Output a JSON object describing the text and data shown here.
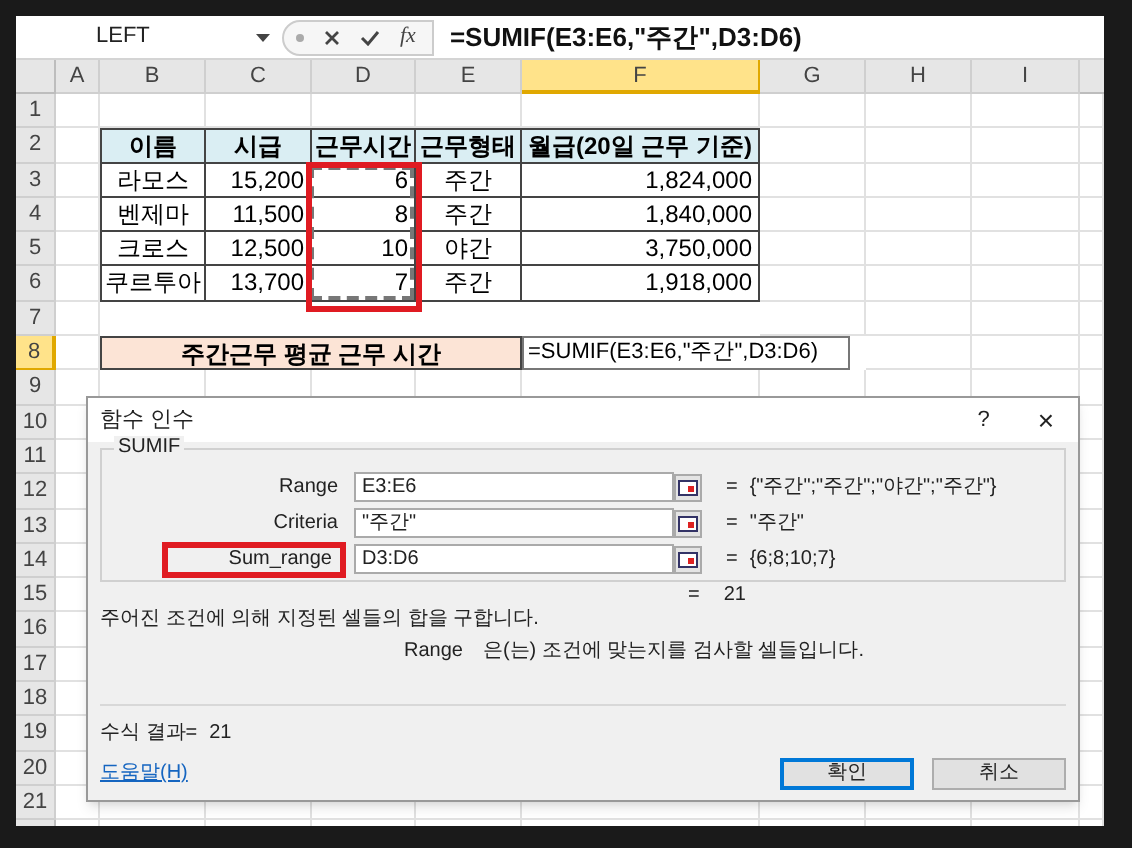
{
  "formula_bar": {
    "name_box": "LEFT",
    "fx": "fx",
    "formula": "=SUMIF(E3:E6,\"주간\",D3:D6)"
  },
  "columns": [
    {
      "label": "A",
      "selected": false
    },
    {
      "label": "B",
      "selected": false
    },
    {
      "label": "C",
      "selected": false
    },
    {
      "label": "D",
      "selected": false
    },
    {
      "label": "E",
      "selected": false
    },
    {
      "label": "F",
      "selected": true
    },
    {
      "label": "G",
      "selected": false
    },
    {
      "label": "H",
      "selected": false
    },
    {
      "label": "I",
      "selected": false
    }
  ],
  "rows": [
    {
      "label": "1",
      "selected": false
    },
    {
      "label": "2",
      "selected": false
    },
    {
      "label": "3",
      "selected": false
    },
    {
      "label": "4",
      "selected": false
    },
    {
      "label": "5",
      "selected": false
    },
    {
      "label": "6",
      "selected": false
    },
    {
      "label": "7",
      "selected": false
    },
    {
      "label": "8",
      "selected": true
    },
    {
      "label": "9",
      "selected": false
    },
    {
      "label": "10",
      "selected": false
    },
    {
      "label": "11",
      "selected": false
    },
    {
      "label": "12",
      "selected": false
    },
    {
      "label": "13",
      "selected": false
    },
    {
      "label": "14",
      "selected": false
    },
    {
      "label": "15",
      "selected": false
    },
    {
      "label": "16",
      "selected": false
    },
    {
      "label": "17",
      "selected": false
    },
    {
      "label": "18",
      "selected": false
    },
    {
      "label": "19",
      "selected": false
    },
    {
      "label": "20",
      "selected": false
    },
    {
      "label": "21",
      "selected": false
    }
  ],
  "table": {
    "columns": [
      "이름",
      "시급",
      "근무시간",
      "근무형태",
      "월급(20일 근무 기준)"
    ],
    "rows": [
      [
        "라모스",
        "15,200",
        "6",
        "주간",
        "1,824,000"
      ],
      [
        "벤제마",
        "11,500",
        "8",
        "주간",
        "1,840,000"
      ],
      [
        "크로스",
        "12,500",
        "10",
        "야간",
        "3,750,000"
      ],
      [
        "쿠르투아",
        "13,700",
        "7",
        "주간",
        "1,918,000"
      ]
    ]
  },
  "summary": {
    "label": "주간근무 평균 근무 시간",
    "formula": "=SUMIF(E3:E6,\"주간\",D3:D6)"
  },
  "dialog": {
    "title": "함수 인수",
    "help": "?",
    "close": "×",
    "function": "SUMIF",
    "arguments": [
      {
        "label": "Range",
        "value": "E3:E6",
        "equals": "=",
        "result": "{\"주간\";\"주간\";\"야간\";\"주간\"}",
        "highlighted": false
      },
      {
        "label": "Criteria",
        "value": "\"주간\"",
        "equals": "=",
        "result": "\"주간\"",
        "highlighted": false
      },
      {
        "label": "Sum_range",
        "value": "D3:D6",
        "equals": "=",
        "result": "{6;8;10;7}",
        "highlighted": true
      }
    ],
    "total_equals": "=",
    "total": "21",
    "description": "주어진 조건에 의해 지정된 셀들의 합을 구합니다.",
    "arg_name": "Range",
    "arg_help": "은(는) 조건에 맞는지를 검사할 셀들입니다.",
    "result_label": "수식 결과=",
    "result": "21",
    "help_link": "도움말(H)",
    "buttons": [
      {
        "label": "확인",
        "selected": true
      },
      {
        "label": "취소",
        "selected": false
      }
    ]
  }
}
